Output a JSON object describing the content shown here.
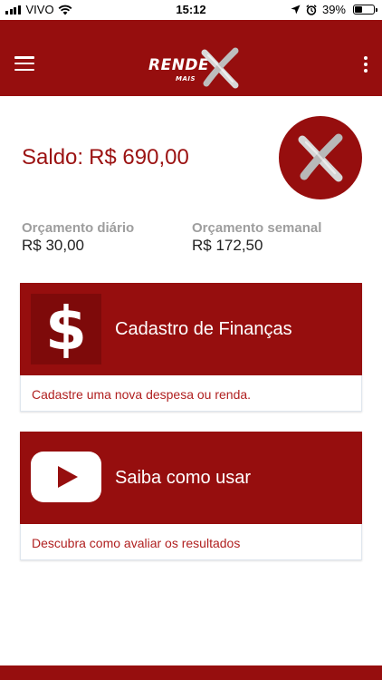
{
  "status_bar": {
    "carrier": "VIVO",
    "time": "15:12",
    "battery": "39%",
    "battery_level": 0.39,
    "icons": [
      "signal-icon",
      "wifi-icon",
      "location-icon",
      "alarm-icon",
      "battery-icon"
    ]
  },
  "app_bar": {
    "logo_main": "RENDE",
    "logo_sub": "MAIS",
    "icons": [
      "menu-icon",
      "more-vert-icon"
    ]
  },
  "balance": {
    "label": "Saldo:",
    "value": "R$ 690,00"
  },
  "budgets": {
    "daily_label": "Orçamento diário",
    "daily_value": "R$ 30,00",
    "weekly_label": "Orçamento semanal",
    "weekly_value": "R$ 172,50"
  },
  "cards": {
    "finance_title": "Cadastro de Finanças",
    "finance_desc": "Cadastre uma nova despesa ou renda.",
    "finance_icon_glyph": "$",
    "howto_title": "Saiba como usar",
    "howto_desc": "Descubra como avaliar os resultados"
  },
  "colors": {
    "primary": "#960e0e",
    "accent_text": "#9b1212",
    "muted": "#9e9e9e"
  }
}
